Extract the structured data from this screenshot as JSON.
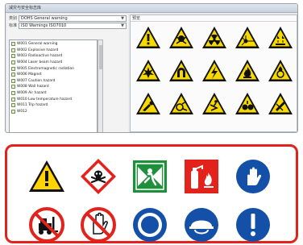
{
  "window": {
    "title": "减灾与安全标志库"
  },
  "left_pane": {
    "type_label": "类别",
    "type_value": "DOHS General warning",
    "std_label": "标准",
    "std_value": "ISO Warnings ISO7010",
    "tree_items": [
      "W001 General warning",
      "W002 Explosive hazard",
      "W003 Radioactive hazard",
      "W004 Laser beam hazard",
      "W005 Electromagnetic radiation",
      "W006 Magnet",
      "W007 Caution hazard",
      "W008 Wall hazard",
      "W009 Air hazard",
      "W010 Low temperature hazard",
      "W011 Trip hazard",
      "W012"
    ]
  },
  "right_pane": {
    "title": "预览",
    "icons": [
      "general-warning-icon",
      "toxic-warning-icon",
      "radiation-warning-icon",
      "laser-warning-icon",
      "corrosive-warning-icon",
      "explosion-warning-icon",
      "magnet-warning-icon",
      "electric-warning-icon",
      "flammable-warning-icon",
      "oxidizer-warning-icon",
      "crush-hands-warning-icon",
      "machinery-warning-icon",
      "slip-warning-icon",
      "roller-warning-icon",
      "cutting-warning-icon"
    ]
  },
  "callout": {
    "signs": [
      {
        "icon": "general-warning-sign",
        "color": "#ffd400"
      },
      {
        "icon": "toxic-warning-sign",
        "color": "#e2221b"
      },
      {
        "icon": "emergency-exit-sign",
        "color": "#1e8f3a"
      },
      {
        "icon": "fire-extinguisher-sign",
        "color": "#e2221b"
      },
      {
        "icon": "wear-gloves-sign",
        "color": "#1550a8"
      },
      {
        "icon": "no-forklift-sign",
        "color": "#e2221b"
      },
      {
        "icon": "no-touching-sign",
        "color": "#e2221b"
      },
      {
        "icon": "wear-ear-protection-sign",
        "color": "#1550a8"
      },
      {
        "icon": "wear-helmet-sign",
        "color": "#1550a8"
      },
      {
        "icon": "general-mandatory-sign",
        "color": "#1550a8"
      }
    ]
  }
}
